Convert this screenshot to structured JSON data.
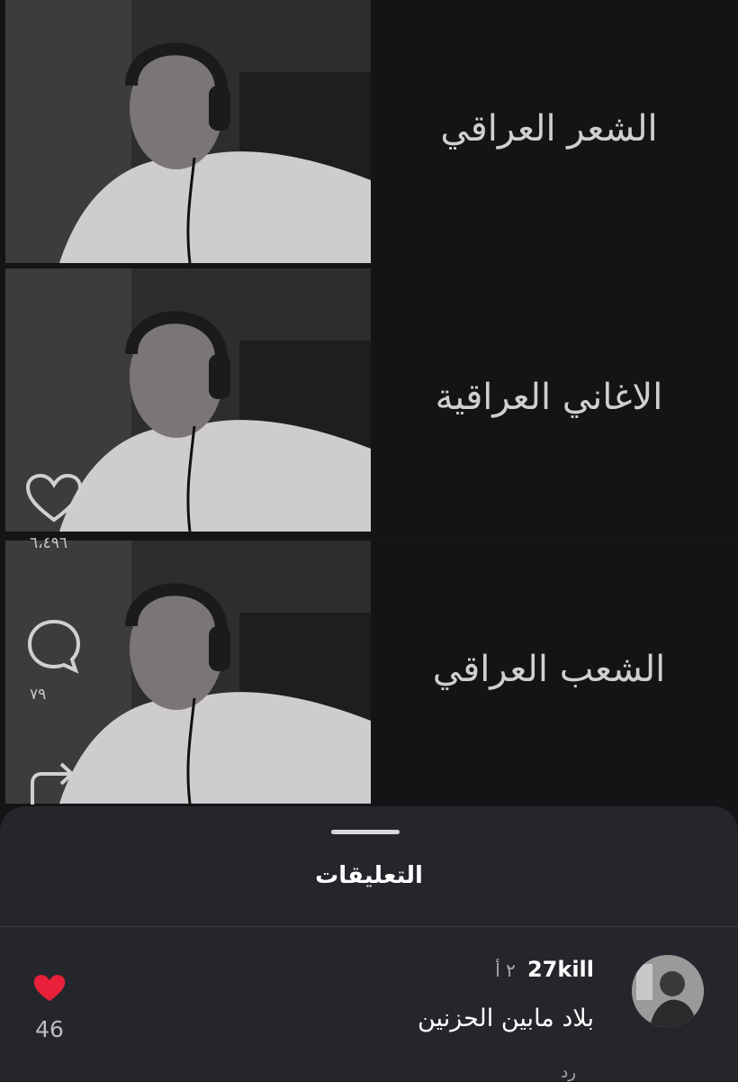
{
  "reel": {
    "captions": [
      "الشعر العراقي",
      "الاغاني العراقية",
      "الشعب العراقي"
    ],
    "like_count": "٦،٤٩٦",
    "comment_count": "٧٩"
  },
  "comments_sheet": {
    "title": "التعليقات",
    "comment": {
      "username": "27kill",
      "time": "٢ أ",
      "text": "بلاد مابين الحزنين",
      "reply_partial": "رد",
      "like_count": "46"
    }
  },
  "colors": {
    "background": "#121214",
    "sheet": "#25262b",
    "heart_red": "#e8203a",
    "caption_gray": "#cfcfcf"
  },
  "icons": {
    "like": "heart-outline-icon",
    "comment": "speech-bubble-icon",
    "share": "share-arrow-icon",
    "comment_like": "heart-filled-icon"
  }
}
